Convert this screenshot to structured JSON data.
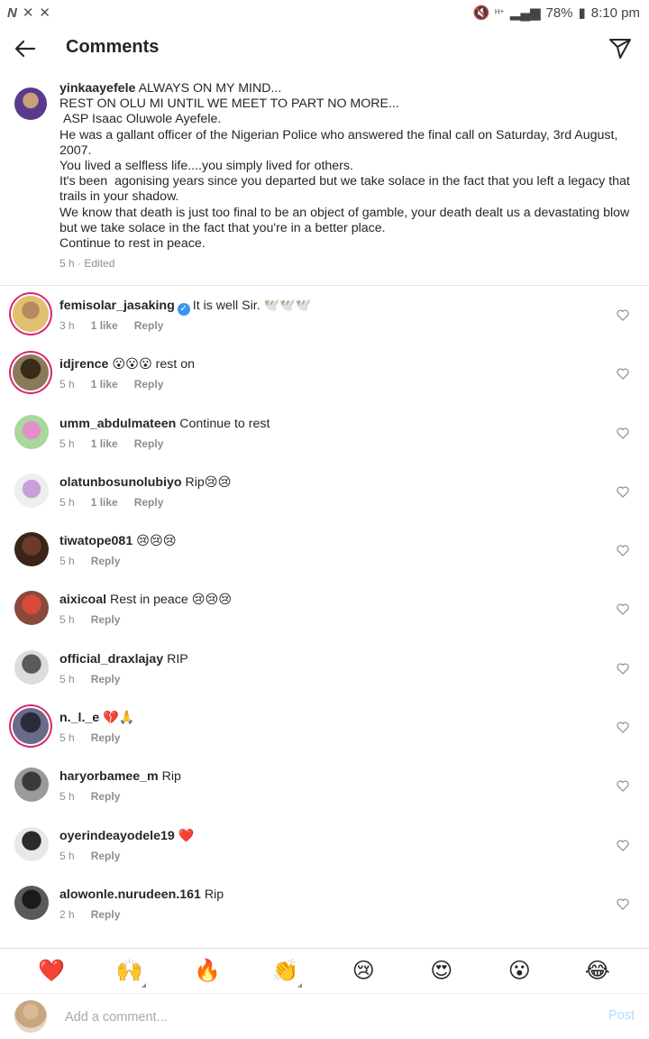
{
  "status_bar": {
    "left_icons": [
      "N",
      "✕",
      "✕"
    ],
    "signal": "ᴴ⁺",
    "battery": "78%",
    "time": "8:10 pm"
  },
  "header": {
    "title": "Comments"
  },
  "caption": {
    "username": "yinkaayefele",
    "text": " ALWAYS ON MY MIND...\nREST ON OLU MI UNTIL WE MEET TO PART NO MORE...\n ASP Isaac Oluwole Ayefele.\nHe was a gallant officer of the Nigerian Police who answered the final call on Saturday, 3rd August, 2007.\nYou lived a selfless life....you simply lived for others.\nIt's been  agonising years since you departed but we take solace in the fact that you left a legacy that trails in your shadow.\nWe know that death is just too final to be an object of gamble, your death dealt us a devastating blow but we take solace in the fact that you're in a better place.\nContinue to rest in peace.",
    "meta": "5 h · Edited"
  },
  "comments": [
    {
      "username": "femisolar_jasaking",
      "verified": "✓",
      "text": "It is well Sir. 🕊️🕊️🕊️",
      "time": "3 h",
      "likes": "1 like",
      "reply": "Reply"
    },
    {
      "username": "idjrence",
      "text": "😮😮😮 rest on",
      "time": "5 h",
      "likes": "1 like",
      "reply": "Reply"
    },
    {
      "username": "umm_abdulmateen",
      "text": "Continue to rest",
      "time": "5 h",
      "likes": "1 like",
      "reply": "Reply"
    },
    {
      "username": "olatunbosunolubiyo",
      "text": "Rip😢😢",
      "time": "5 h",
      "likes": "1 like",
      "reply": "Reply"
    },
    {
      "username": "tiwatope081",
      "text": "😢😢😢",
      "time": "5 h",
      "likes": "",
      "reply": "Reply"
    },
    {
      "username": "aixicoal",
      "text": "Rest in peace 😢😢😢",
      "time": "5 h",
      "likes": "",
      "reply": "Reply"
    },
    {
      "username": "official_draxlajay",
      "text": "RIP",
      "time": "5 h",
      "likes": "",
      "reply": "Reply"
    },
    {
      "username": "n._l._e",
      "text": "💔🙏",
      "time": "5 h",
      "likes": "",
      "reply": "Reply"
    },
    {
      "username": "haryorbamee_m",
      "text": "Rip",
      "time": "5 h",
      "likes": "",
      "reply": "Reply"
    },
    {
      "username": "oyerindeayodele19",
      "text": "❤️",
      "time": "5 h",
      "likes": "",
      "reply": "Reply"
    },
    {
      "username": "alowonle.nurudeen.161",
      "text": "Rip",
      "time": "2 h",
      "likes": "",
      "reply": "Reply"
    }
  ],
  "reactions": [
    "❤️",
    "🙌",
    "🔥",
    "👏",
    "😢",
    "😍",
    "😮",
    "😂"
  ],
  "composer": {
    "placeholder": "Add a comment...",
    "post_label": "Post"
  },
  "colors": {
    "accent": "#3897f0",
    "ring": "#d6296f",
    "post_disabled": "#b3dbff"
  }
}
